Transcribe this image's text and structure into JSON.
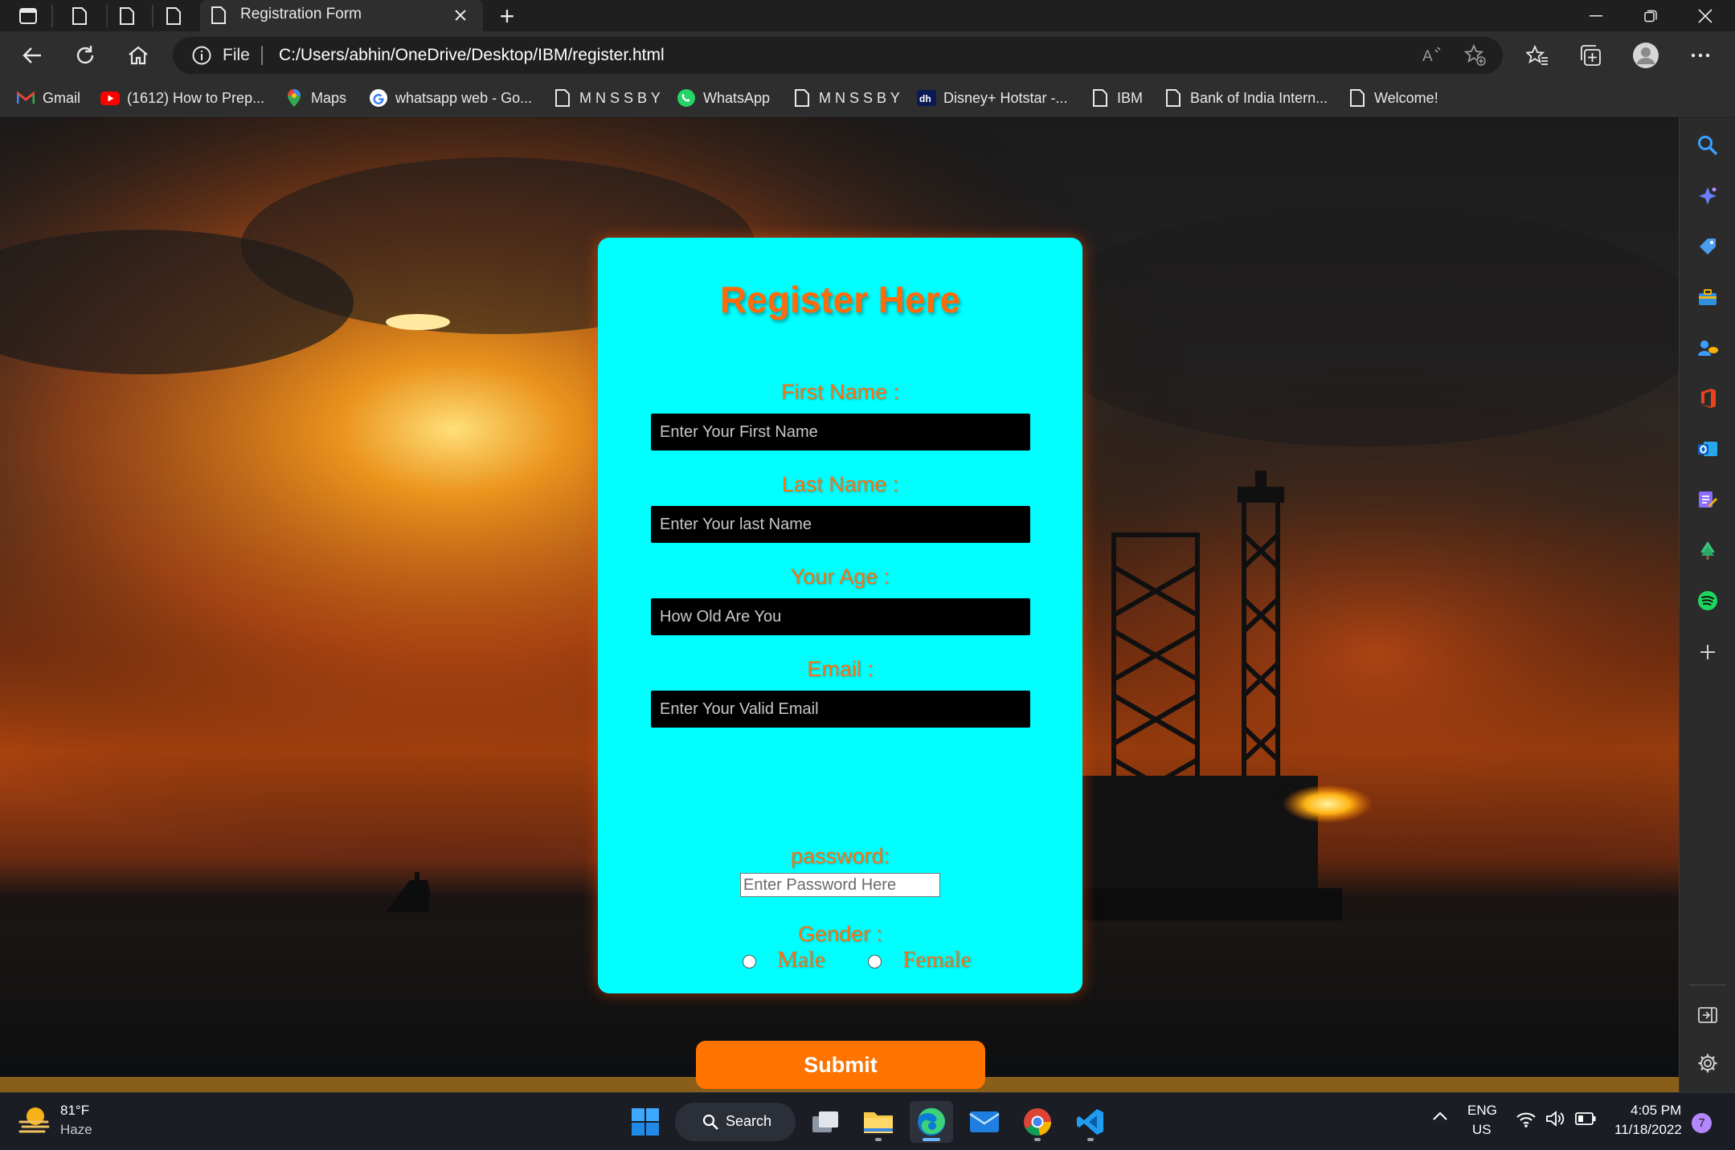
{
  "tabs": {
    "active_title": "Registration Form",
    "new_tab_symbol": "+"
  },
  "address_bar": {
    "scheme": "File",
    "url": "C:/Users/abhin/OneDrive/Desktop/IBM/register.html"
  },
  "bookmarks": [
    {
      "label": "Gmail",
      "icon": "gmail-icon"
    },
    {
      "label": "(1612) How to Prep...",
      "icon": "youtube-icon"
    },
    {
      "label": "Maps",
      "icon": "maps-icon"
    },
    {
      "label": "whatsapp web - Go...",
      "icon": "google-icon"
    },
    {
      "label": "M N S S B Y",
      "icon": "page-icon"
    },
    {
      "label": "WhatsApp",
      "icon": "whatsapp-icon"
    },
    {
      "label": "M N S S B Y",
      "icon": "page-icon"
    },
    {
      "label": "Disney+ Hotstar -...",
      "icon": "hotstar-icon"
    },
    {
      "label": "IBM",
      "icon": "page-icon"
    },
    {
      "label": "Bank of India Intern...",
      "icon": "page-icon"
    },
    {
      "label": "Welcome!",
      "icon": "page-icon"
    }
  ],
  "form": {
    "heading": "Register Here",
    "first_name": {
      "label": "First Name :",
      "placeholder": "Enter Your First Name"
    },
    "last_name": {
      "label": "Last Name :",
      "placeholder": "Enter Your last Name"
    },
    "age": {
      "label": "Your Age :",
      "placeholder": "How Old Are You"
    },
    "email": {
      "label": "Email :",
      "placeholder": "Enter Your Valid Email"
    },
    "password": {
      "label": "password:",
      "placeholder": "Enter Password Here"
    },
    "gender": {
      "label": "Gender :",
      "options": [
        "Male",
        "Female"
      ]
    },
    "submit_label": "Submit"
  },
  "taskbar": {
    "weather": {
      "temp": "81°F",
      "condition": "Haze"
    },
    "search_label": "Search",
    "language": {
      "line1": "ENG",
      "line2": "US"
    },
    "clock": {
      "time": "4:05 PM",
      "date": "11/18/2022"
    },
    "notification_count": "7"
  },
  "colors": {
    "card_bg": "#00ffff",
    "accent_orange": "#ff6a0a",
    "submit_bg": "#ff7300",
    "input_bg": "#000000"
  }
}
